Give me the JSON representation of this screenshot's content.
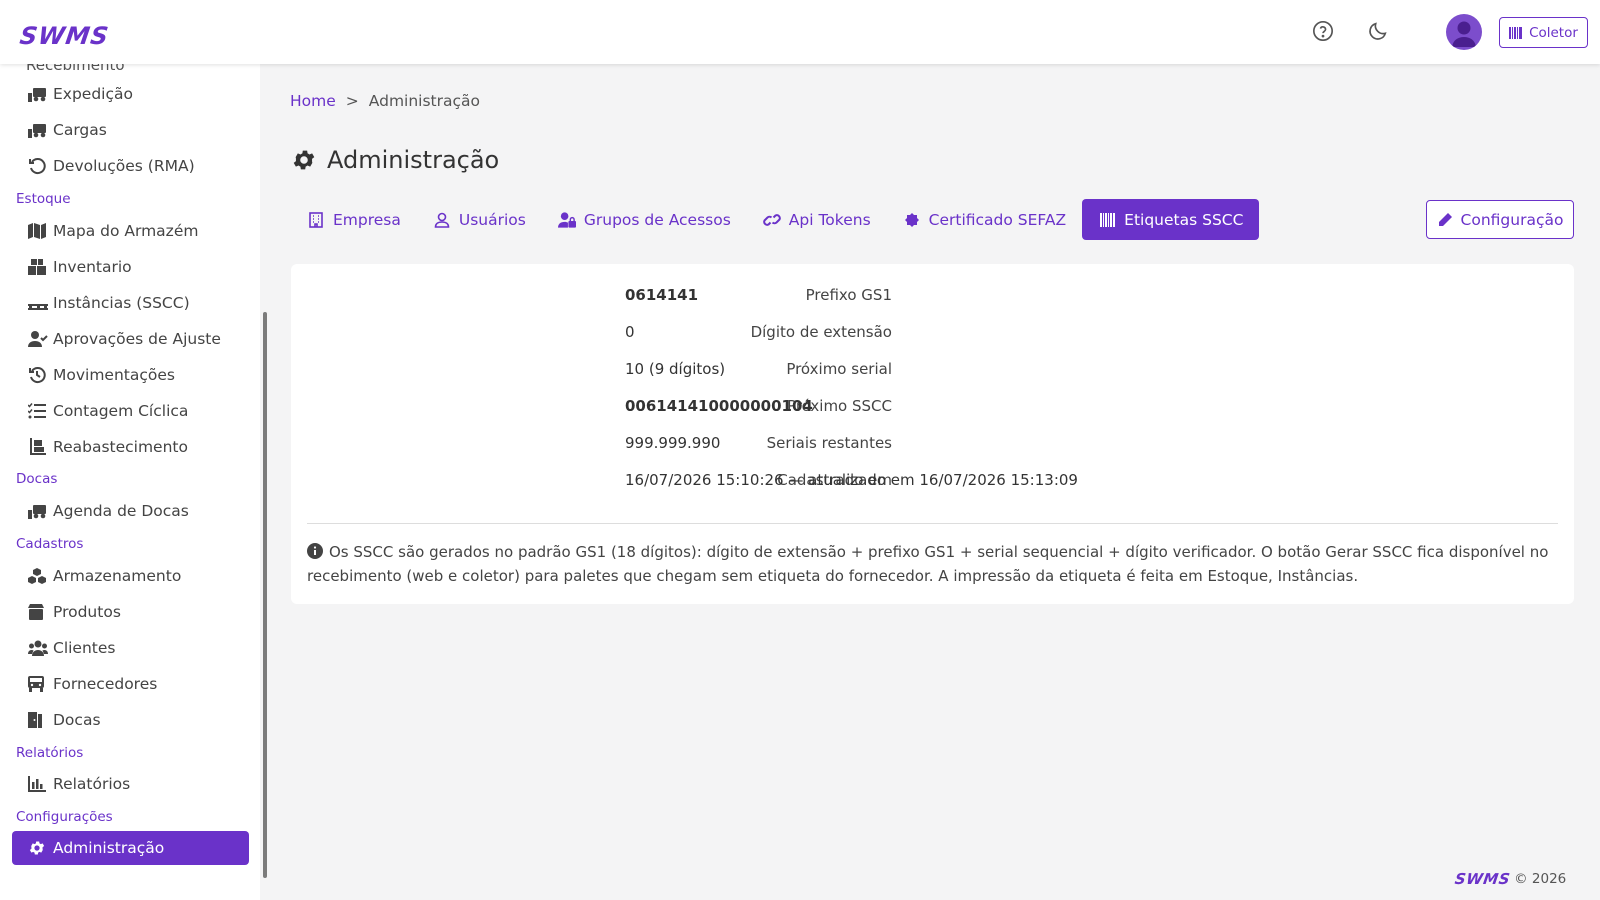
{
  "header": {
    "logo": "SWMS",
    "help_icon": "help-circle-icon",
    "theme_icon": "moon-icon",
    "coletor_label": "Coletor"
  },
  "sidebar": {
    "cut_item": "Recebimento",
    "groups": [
      {
        "section": "",
        "items": [
          {
            "label": "Expedição",
            "icon": "truck-loading-icon"
          },
          {
            "label": "Cargas",
            "icon": "truck-loading-icon"
          },
          {
            "label": "Devoluções (RMA)",
            "icon": "undo-icon"
          }
        ]
      },
      {
        "section": "Estoque",
        "items": [
          {
            "label": "Mapa do Armazém",
            "icon": "map-icon"
          },
          {
            "label": "Inventario",
            "icon": "boxes-icon"
          },
          {
            "label": "Instâncias (SSCC)",
            "icon": "pallet-icon"
          },
          {
            "label": "Aprovações de Ajuste",
            "icon": "user-check-icon"
          },
          {
            "label": "Movimentações",
            "icon": "history-icon"
          },
          {
            "label": "Contagem Cíclica",
            "icon": "list-check-icon"
          },
          {
            "label": "Reabastecimento",
            "icon": "dolly-icon"
          }
        ]
      },
      {
        "section": "Docas",
        "items": [
          {
            "label": "Agenda de Docas",
            "icon": "truck-loading-icon"
          }
        ]
      },
      {
        "section": "Cadastros",
        "items": [
          {
            "label": "Armazenamento",
            "icon": "cubes-icon"
          },
          {
            "label": "Produtos",
            "icon": "box-icon"
          },
          {
            "label": "Clientes",
            "icon": "users-icon"
          },
          {
            "label": "Fornecedores",
            "icon": "truck-icon"
          },
          {
            "label": "Docas",
            "icon": "door-icon"
          }
        ]
      },
      {
        "section": "Relatórios",
        "items": [
          {
            "label": "Relatórios",
            "icon": "chart-bar-icon"
          }
        ]
      },
      {
        "section": "Configurações",
        "items": [
          {
            "label": "Administração",
            "icon": "gear-icon",
            "active": true
          }
        ]
      }
    ]
  },
  "breadcrumb": {
    "home": "Home",
    "separator": ">",
    "current": "Administração"
  },
  "page": {
    "title": "Administração"
  },
  "tabs": [
    {
      "label": "Empresa",
      "icon": "building-icon"
    },
    {
      "label": "Usuários",
      "icon": "user-icon"
    },
    {
      "label": "Grupos de Acessos",
      "icon": "user-lock-icon"
    },
    {
      "label": "Api Tokens",
      "icon": "link-icon"
    },
    {
      "label": "Certificado SEFAZ",
      "icon": "certificate-icon"
    },
    {
      "label": "Etiquetas SSCC",
      "icon": "barcode-icon",
      "active": true
    }
  ],
  "config_button": "Configuração",
  "details": [
    {
      "label": "Prefixo GS1",
      "value": "0614141",
      "bold": true
    },
    {
      "label": "Dígito de extensão",
      "value": "0",
      "bold": false
    },
    {
      "label": "Próximo serial",
      "value": "10 (9 dígitos)",
      "bold": false
    },
    {
      "label": "Próximo SSCC",
      "value": "006141410000000104",
      "bold": true
    },
    {
      "label": "Seriais restantes",
      "value": "999.999.990",
      "bold": false
    },
    {
      "label": "Cadastrado em",
      "value": "16/07/2026 15:10:26 — atualizado em 16/07/2026 15:13:09",
      "bold": false
    }
  ],
  "info_text": "Os SSCC são gerados no padrão GS1 (18 dígitos): dígito de extensão + prefixo GS1 + serial sequencial + dígito verificador. O botão Gerar SSCC fica disponível no recebimento (web e coletor) para paletes que chegam sem etiqueta do fornecedor. A impressão da etiqueta é feita em Estoque, Instâncias.",
  "footer": {
    "logo": "SWMS",
    "copyright": "© 2026"
  },
  "colors": {
    "accent": "#6a32c9",
    "background": "#f4f4f5"
  }
}
